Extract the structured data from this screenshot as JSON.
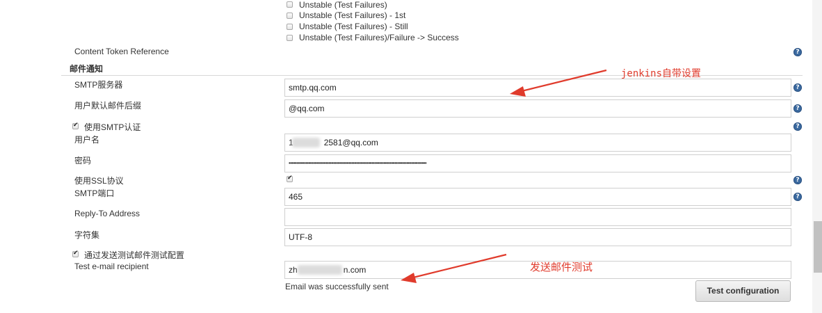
{
  "triggers": [
    "Unstable (Test Failures)",
    "Unstable (Test Failures) - 1st",
    "Unstable (Test Failures) - Still",
    "Unstable (Test Failures)/Failure -> Success"
  ],
  "content_token_label": "Content Token Reference",
  "section_title": "邮件通知",
  "fields": {
    "smtp_server": {
      "label": "SMTP服务器",
      "value": "smtp.qq.com"
    },
    "default_suffix": {
      "label": "用户默认邮件后缀",
      "value": "@qq.com"
    },
    "use_smtp_auth": {
      "label": "使用SMTP认证",
      "checked": true
    },
    "username": {
      "label": "用户名",
      "value_prefix": "1",
      "value_suffix": "2581@qq.com"
    },
    "password": {
      "label": "密码",
      "value": "••••••••••••••••••••••••••••••••••••••••••••••••••••••••••••••••••••••••••••••••••••••••••"
    },
    "use_ssl": {
      "label": "使用SSL协议",
      "checked": true
    },
    "smtp_port": {
      "label": "SMTP端口",
      "value": "465"
    },
    "reply_to": {
      "label": "Reply-To Address",
      "value": ""
    },
    "charset": {
      "label": "字符集",
      "value": "UTF-8"
    },
    "test_by_sending": {
      "label": "通过发送测试邮件测试配置",
      "checked": true
    },
    "test_recipient": {
      "label": "Test e-mail recipient",
      "value_prefix": "zh",
      "value_suffix": "n.com"
    }
  },
  "status_message": "Email was successfully sent",
  "test_button_label": "Test configuration",
  "annotations": {
    "jenkins_builtin": "jenkins自带设置",
    "send_test": "发送邮件测试",
    "color": "#e03b2c"
  },
  "help_icon_glyph": "?"
}
